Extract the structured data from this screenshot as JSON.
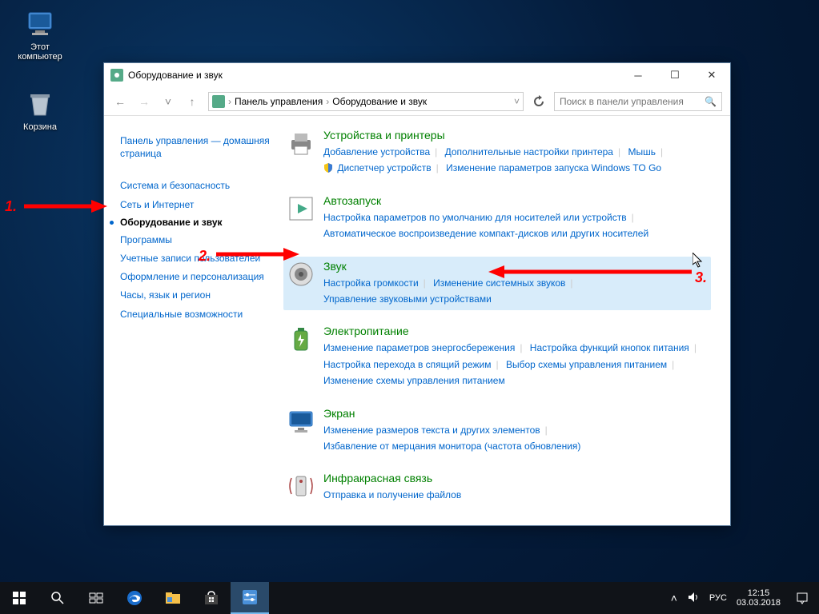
{
  "desktop": {
    "this_pc": "Этот компьютер",
    "recycle": "Корзина"
  },
  "window": {
    "title": "Оборудование и звук",
    "breadcrumbs": [
      "Панель управления",
      "Оборудование и звук"
    ],
    "search_placeholder": "Поиск в панели управления"
  },
  "sidebar": {
    "home": "Панель управления — домашняя страница",
    "items": [
      "Система и безопасность",
      "Сеть и Интернет",
      "Оборудование и звук",
      "Программы",
      "Учетные записи пользователей",
      "Оформление и персонализация",
      "Часы, язык и регион",
      "Специальные возможности"
    ],
    "current_index": 2
  },
  "main": {
    "cats": [
      {
        "title": "Устройства и принтеры",
        "links": [
          "Добавление устройства",
          "Дополнительные настройки принтера",
          "Мышь",
          "Диспетчер устройств",
          "Изменение параметров запуска Windows TO Go"
        ],
        "shield_at": 3
      },
      {
        "title": "Автозапуск",
        "links": [
          "Настройка параметров по умолчанию для носителей или устройств",
          "Автоматическое воспроизведение компакт-дисков или других носителей"
        ]
      },
      {
        "title": "Звук",
        "links": [
          "Настройка громкости",
          "Изменение системных звуков",
          "Управление звуковыми устройствами"
        ],
        "highlight": true
      },
      {
        "title": "Электропитание",
        "links": [
          "Изменение параметров энергосбережения",
          "Настройка функций кнопок питания",
          "Настройка перехода в спящий режим",
          "Выбор схемы управления питанием",
          "Изменение схемы управления питанием"
        ]
      },
      {
        "title": "Экран",
        "links": [
          "Изменение размеров текста и других элементов",
          "Избавление от мерцания монитора (частота обновления)"
        ]
      },
      {
        "title": "Инфракрасная связь",
        "links": [
          "Отправка и получение файлов"
        ]
      }
    ]
  },
  "annotations": {
    "n1": "1.",
    "n2": "2.",
    "n3": "3."
  },
  "tray": {
    "lang": "РУС",
    "time": "12:15",
    "date": "03.03.2018"
  }
}
